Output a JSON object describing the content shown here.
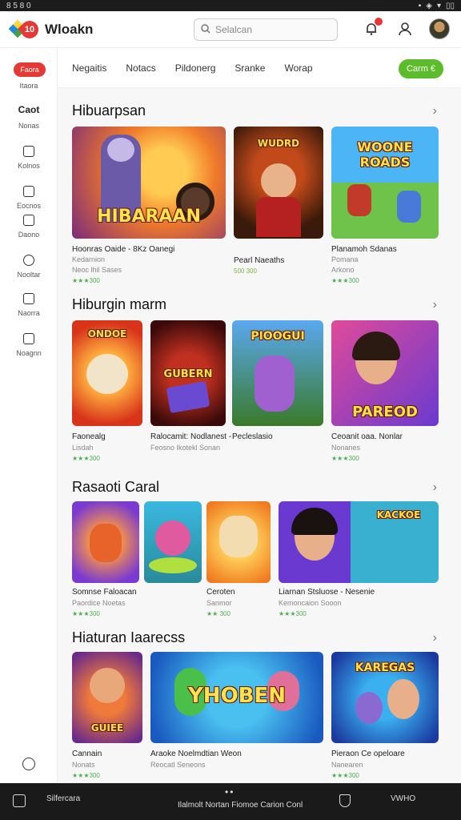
{
  "status_bar": {
    "left": "8 5 8 0",
    "right_icons": [
      "▪",
      "◈",
      "▾",
      "▯▯"
    ]
  },
  "header": {
    "logo_letter": "10",
    "brand": "Wloakn",
    "search_placeholder": "Selalcan"
  },
  "sidebar": {
    "pill": "Faora",
    "items": [
      {
        "label": "Itaora"
      },
      {
        "heading": "Caot",
        "label": "Nonas"
      },
      {
        "label": "Kolnos"
      },
      {
        "label": "Eocnos"
      },
      {
        "label": "Daono"
      },
      {
        "label": "Nooltar"
      },
      {
        "label": "Naorra"
      },
      {
        "label": "Noagnn"
      }
    ]
  },
  "tabs": [
    "Negaitis",
    "Notacs",
    "Pildonerg",
    "Sranke",
    "Worap"
  ],
  "tab_cta": "Carm €",
  "sections": [
    {
      "title": "Hibuarpsan",
      "cards": [
        {
          "art": "HIBARAAN",
          "title": "Hoonras Oaide - 8Kz Oanegi",
          "sub": "Kedarnion",
          "sub2": "Neoc lhil Sases",
          "rating": "★★★300"
        },
        {
          "art": "WUDRD",
          "title": "Pearl Naeaths",
          "sub": "",
          "sub2": "",
          "rating": "500 300"
        },
        {
          "art": "WOONE ROADS",
          "title": "Planamoh Sdanas",
          "sub": "Pomana",
          "sub2": "Arkono",
          "rating": "★★★300"
        }
      ]
    },
    {
      "title": "Hiburgin marm",
      "cards": [
        {
          "art": "ONDOE",
          "title": "Faonealg",
          "sub": "Lisdah",
          "rating": "★★★300"
        },
        {
          "art": "GUBERN",
          "title": "Ralocamit: Nodlanest -",
          "sub": "Feosno Ikotekl Sonan",
          "rating": ""
        },
        {
          "art": "PIOOGUI",
          "title": "Pecleslasio",
          "sub": "",
          "rating": ""
        },
        {
          "art": "PAREOD",
          "title": "Ceoanit oaa. Nonlar",
          "sub": "Nonanes",
          "rating": "★★★300"
        }
      ]
    },
    {
      "title": "Rasaoti Caral",
      "cards": [
        {
          "art": "",
          "title": "Somnse Faloacan",
          "sub": "Paordice Noetas",
          "rating": "★★★300"
        },
        {
          "art": "",
          "title": "",
          "sub": "",
          "rating": ""
        },
        {
          "art": "",
          "title": "Ceroten",
          "sub": "Sanmor",
          "rating": "★★ 300"
        },
        {
          "art": "KACKOE",
          "title": "Liarnan Stsluose - Nesenie",
          "sub": "Kemoncaion Sooon",
          "rating": "★★★300"
        }
      ]
    },
    {
      "title": "Hiaturan Iaarecss",
      "cards": [
        {
          "art": "GUIEE",
          "title": "Cannain",
          "sub": "Nonats",
          "rating": "★★★300"
        },
        {
          "art": "YHOBEN",
          "title": "Araoke Noelmdtian Weon",
          "sub": "Reocatl Seneons",
          "rating": ""
        },
        {
          "art": "KAREGAS",
          "title": "Pieraon Ce opeloare",
          "sub": "Nanearen",
          "rating": "★★★300"
        }
      ]
    }
  ],
  "bottom_bar": {
    "left_label": "Silfercara",
    "center_label": "Ilalmolt Nortan Fiomoe Carion Conl",
    "right_label": "VWHO"
  },
  "colors": {
    "accent_red": "#e53935",
    "accent_green": "#5cbc2c"
  }
}
